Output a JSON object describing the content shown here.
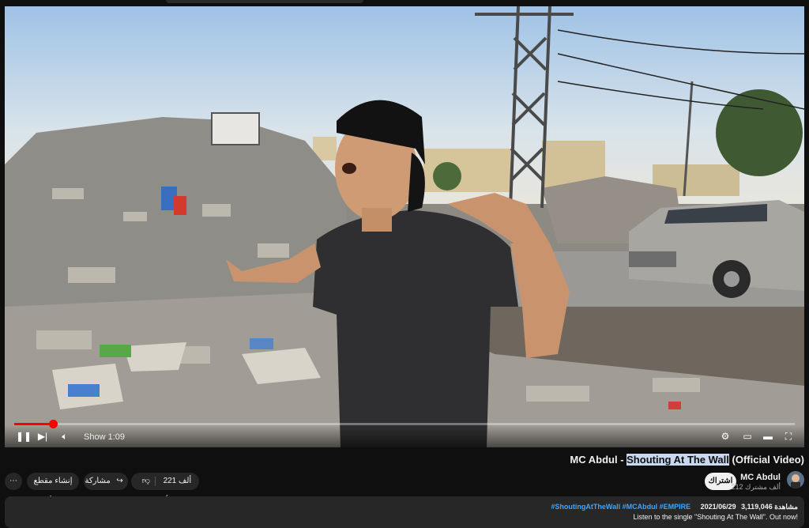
{
  "video": {
    "title_prefix": "MC Abdul - ",
    "title_highlight": "Shouting At The Wall",
    "title_suffix": " (Official Video)",
    "time_display": "Show 1:09",
    "progress_fraction": 0.05
  },
  "actions": {
    "more": "⋯",
    "clip_label": "إنشاء مقطع",
    "share_label": "مشاركة",
    "like_count": "221 ألف"
  },
  "channel": {
    "name": "MC Abdul",
    "subscribers": "212 ألف مشترك",
    "subscribe_label": "اشتراك"
  },
  "description": {
    "views": "3,119,046 مشاهدة",
    "date": "2021/06/29",
    "hashtags": "#ShoutingAtTheWall #MCAbdul #EMPIRE",
    "line1": "Listen to the single \"Shouting At The Wall\". Out now!"
  },
  "colors": {
    "accent": "#ff0000",
    "link": "#3ea6ff",
    "highlight": "#c8d8f0"
  },
  "icons": [
    "play-icon",
    "next-icon",
    "volume-icon",
    "settings-icon",
    "miniplayer-icon",
    "theater-icon",
    "fullscreen-icon",
    "like-icon",
    "dislike-icon",
    "share-icon",
    "scissors-icon",
    "more-icon"
  ]
}
